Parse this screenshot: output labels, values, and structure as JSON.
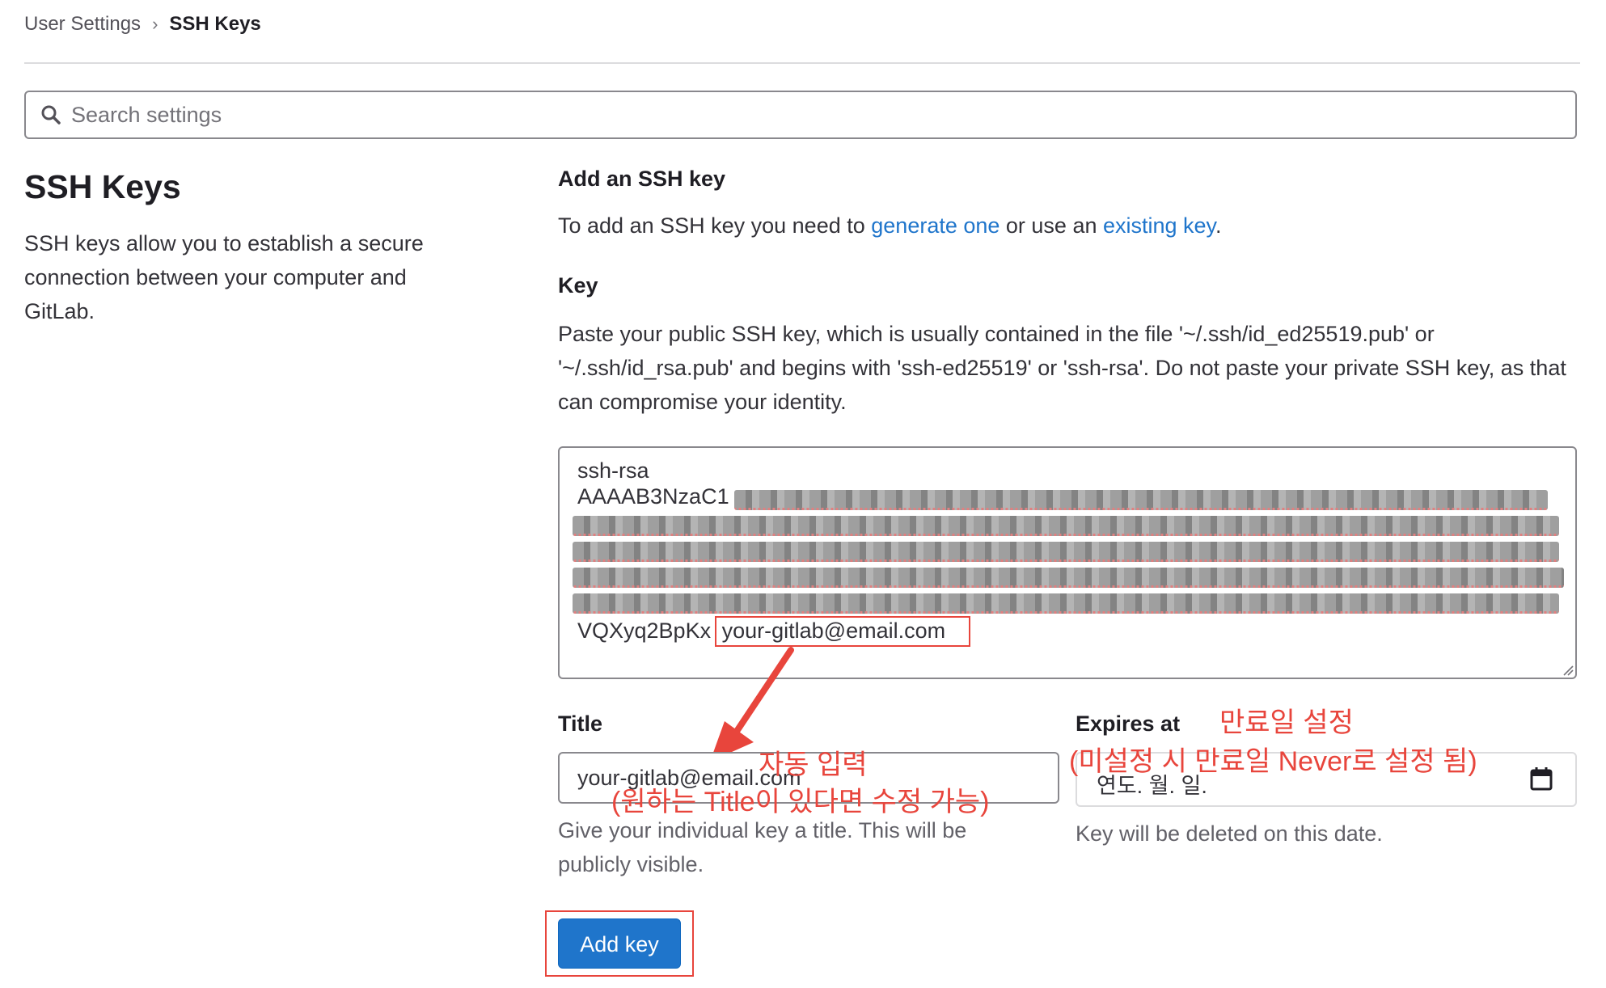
{
  "breadcrumb": {
    "parent": "User Settings",
    "current": "SSH Keys"
  },
  "search": {
    "placeholder": "Search settings"
  },
  "section": {
    "title": "SSH Keys",
    "description": "SSH keys allow you to establish a secure connection between your computer and GitLab."
  },
  "form": {
    "heading": "Add an SSH key",
    "intro_prefix": "To add an SSH key you need to ",
    "link_generate": "generate one",
    "intro_middle": " or use an ",
    "link_existing": "existing key",
    "intro_suffix": ".",
    "key_label": "Key",
    "key_help": "Paste your public SSH key, which is usually contained in the file '~/.ssh/id_ed25519.pub' or '~/.ssh/id_rsa.pub' and begins with 'ssh-ed25519' or 'ssh-rsa'. Do not paste your private SSH key, as that can compromise your identity.",
    "key_line1": "ssh-rsa",
    "key_line2_visible": "AAAAB3NzaC1",
    "key_last_visible": "VQXyq2BpKx",
    "key_email": "your-gitlab@email.com",
    "title_label": "Title",
    "title_value": "your-gitlab@email.com",
    "title_help": "Give your individual key a title. This will be publicly visible.",
    "expires_label": "Expires at",
    "expires_placeholder": "연도. 월. 일.",
    "expires_help": "Key will be deleted on this date.",
    "submit_label": "Add key"
  },
  "annotations": {
    "auto_fill_line1": "자동 입력",
    "auto_fill_line2": "(원하는 Title이 있다면 수정 가능)",
    "expiry_line1": "만료일 설정",
    "expiry_line2": "(미설정 시 만료일 Never로 설정 됨)",
    "color": "#e8453c"
  },
  "colors": {
    "link": "#1f75cb",
    "button": "#1f75cb"
  }
}
